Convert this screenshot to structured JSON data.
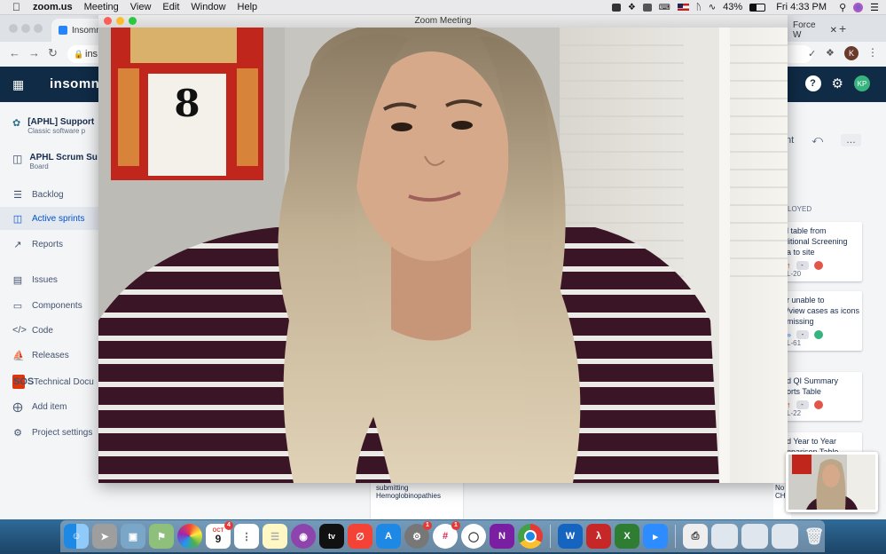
{
  "menubar": {
    "app_name": "zoom.us",
    "menus": [
      "Meeting",
      "View",
      "Edit",
      "Window",
      "Help"
    ],
    "battery": "43%",
    "clock": "Fri 4:33 PM"
  },
  "browser": {
    "tab_left": "Insomnia",
    "tab_right": "Force W",
    "address": "ins",
    "profile_initial": "K",
    "app_logo": "insomni",
    "header_avatar": "KP"
  },
  "sidebar": {
    "projects": [
      {
        "name": "[APHL] Support",
        "sub": "Classic software p"
      },
      {
        "name": "APHL Scrum Su",
        "sub": "Board"
      }
    ],
    "items": [
      {
        "label": "Backlog",
        "icon": "backlog-icon"
      },
      {
        "label": "Active sprints",
        "icon": "board-icon"
      },
      {
        "label": "Reports",
        "icon": "chart-icon"
      },
      {
        "label": "Issues",
        "icon": "issues-icon"
      },
      {
        "label": "Components",
        "icon": "components-icon"
      },
      {
        "label": "Code",
        "icon": "code-icon"
      },
      {
        "label": "Releases",
        "icon": "ship-icon"
      },
      {
        "label": "Technical Docu",
        "icon": "sos-icon"
      },
      {
        "label": "Add item",
        "icon": "add-icon"
      },
      {
        "label": "Project settings",
        "icon": "gear-icon"
      }
    ],
    "sos_label": "SOS"
  },
  "board": {
    "toolbar_text": "nt",
    "column_header": "LOYED",
    "cards": [
      {
        "text": [
          "l table from",
          "litional Screening",
          "a to site"
        ],
        "key": "L-20",
        "avatar": "K"
      },
      {
        "text": [
          "r unable to",
          "/view cases as icons",
          "missing"
        ],
        "key": "L-61",
        "avatar": "KP"
      },
      {
        "text": [
          "d QI Summary",
          "orts Table"
        ],
        "key": "L-22",
        "avatar": "K"
      },
      {
        "text": [
          "d Year to Year",
          "nparison Table"
        ],
        "key": "",
        "avatar": ""
      }
    ],
    "behind_card": [
      "submitting",
      "Hemoglobinopathies"
    ],
    "behind_card2": [
      "No",
      "CH"
    ]
  },
  "zoom": {
    "title": "Zoom Meeting",
    "calendar_day": "8"
  },
  "dock": {
    "calendar_month": "OCT",
    "calendar_day": "9",
    "calendar_badge": "4",
    "settings_badge": "1",
    "slack_badge": "1",
    "tv_label": "tv"
  }
}
